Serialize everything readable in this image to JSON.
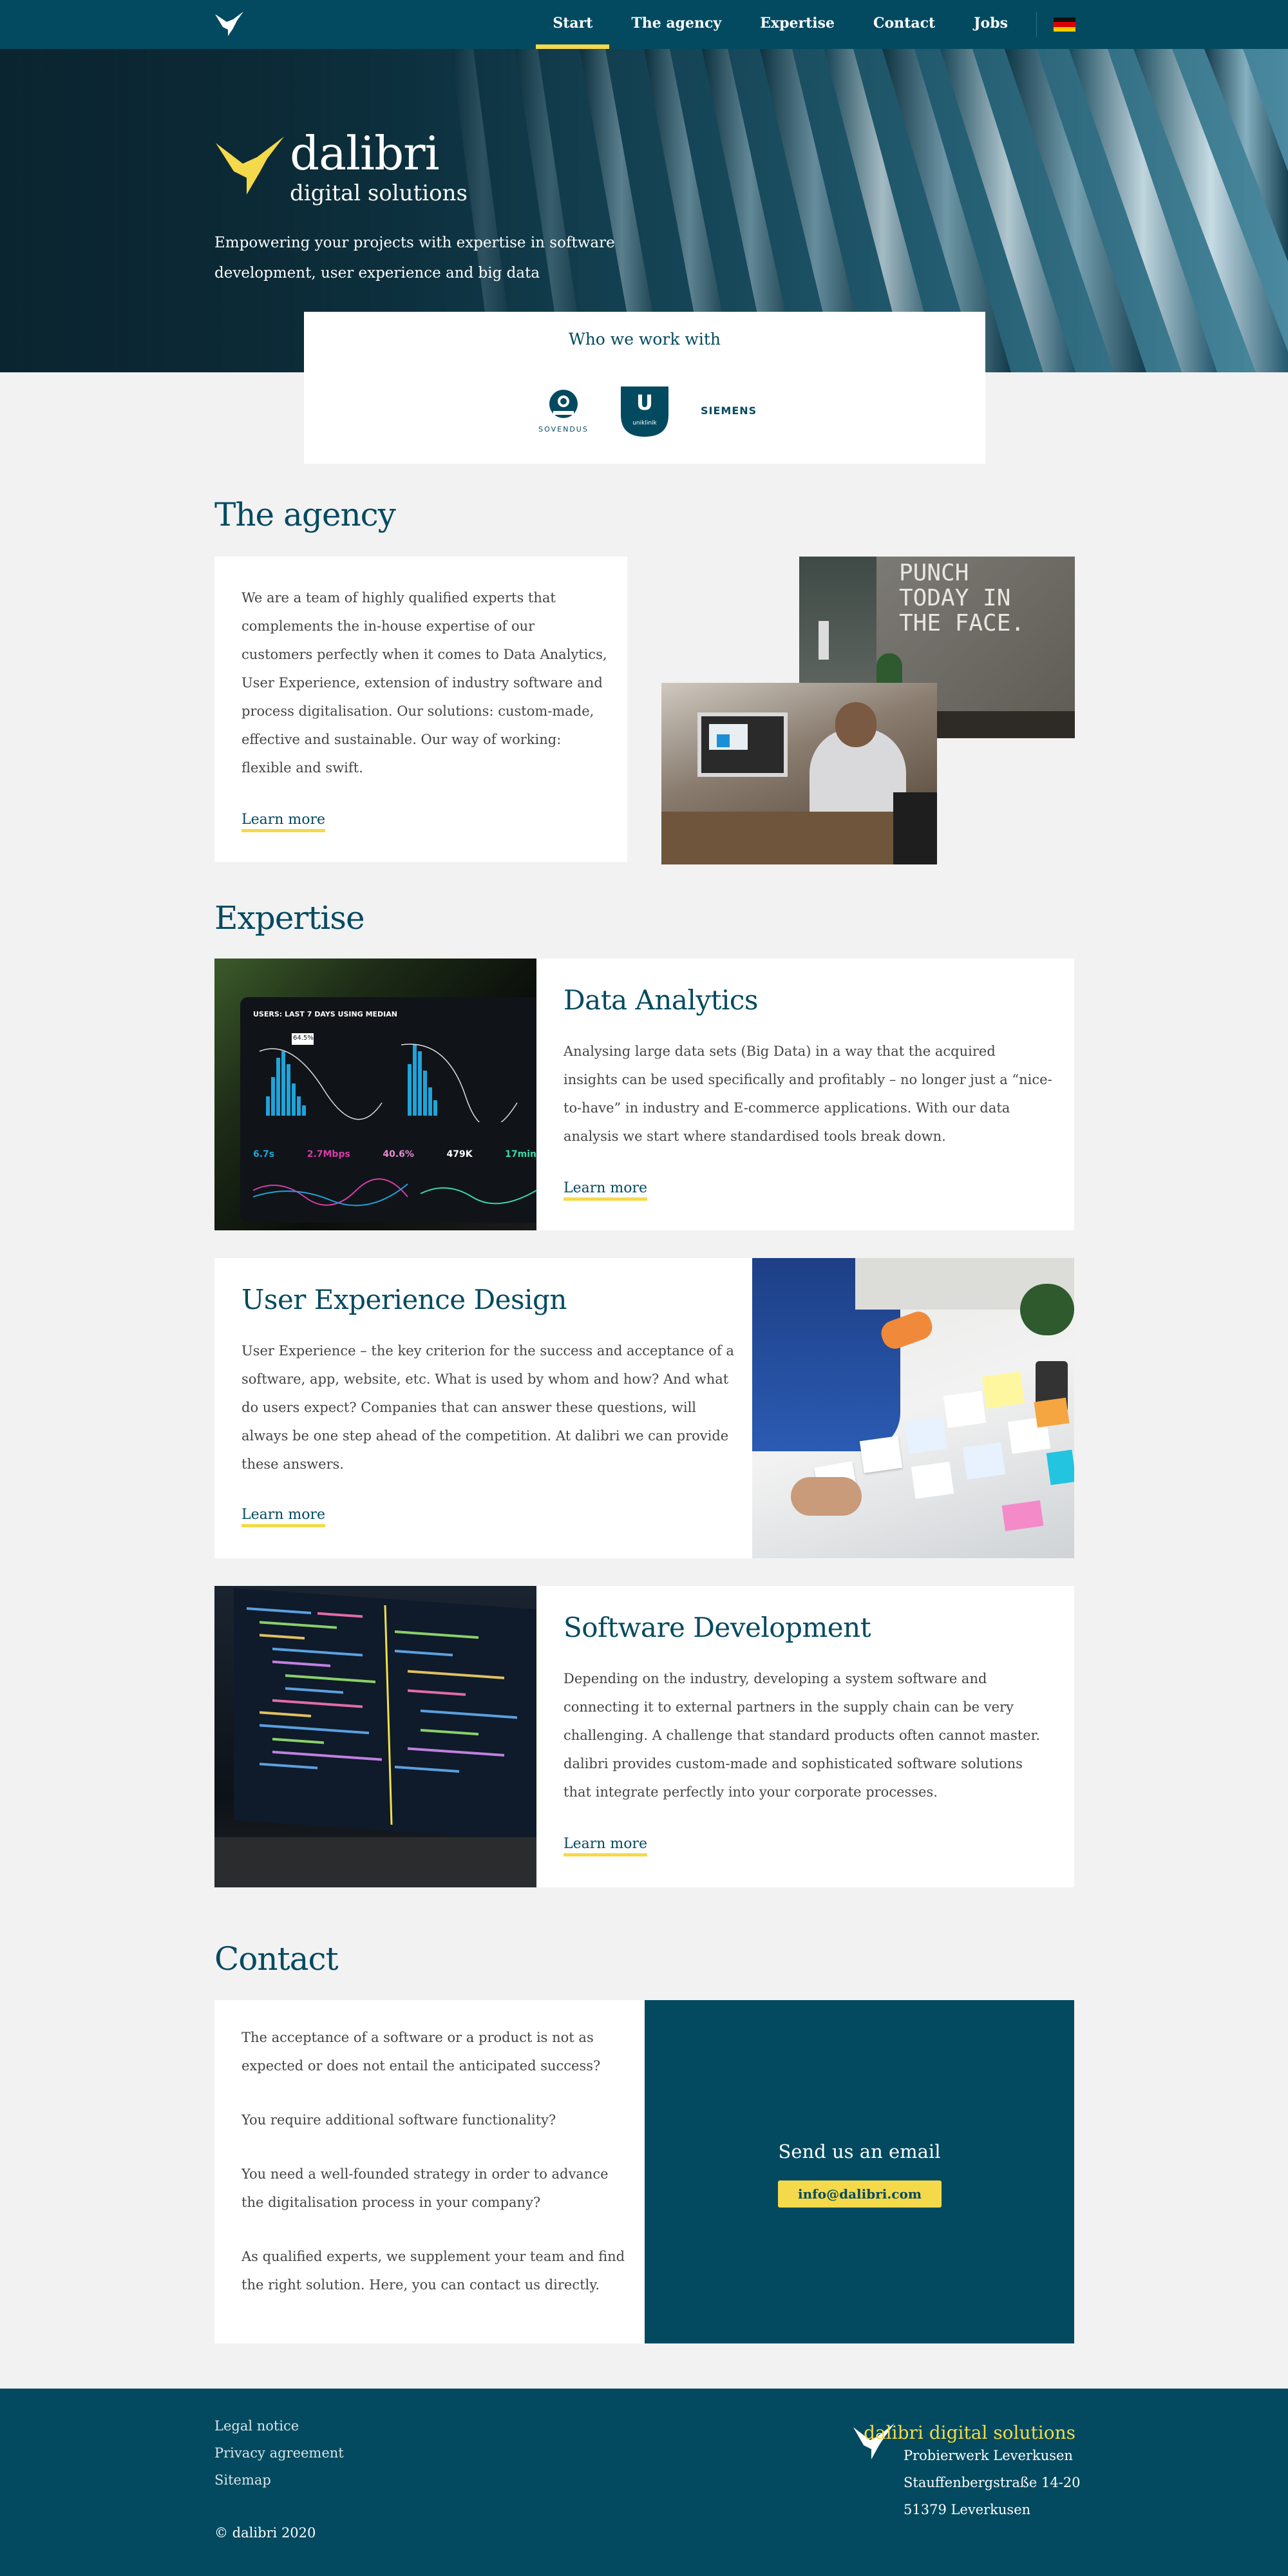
{
  "nav": {
    "items": [
      {
        "label": "Start",
        "active": true
      },
      {
        "label": "The agency"
      },
      {
        "label": "Expertise"
      },
      {
        "label": "Contact"
      },
      {
        "label": "Jobs"
      }
    ],
    "language_flag": "german-flag-icon"
  },
  "hero": {
    "brand": "dalibri",
    "subbrand": "digital solutions",
    "tagline": "Empowering your projects with expertise in software development, user experience and big data"
  },
  "clients": {
    "title": "Who we work with",
    "logos": [
      {
        "name": "sovendus-logo",
        "label": "SOVENDUS"
      },
      {
        "name": "uniklinik-logo",
        "label": "uniklinik",
        "mark": "U"
      },
      {
        "name": "siemens-logo",
        "label": "SIEMENS"
      }
    ]
  },
  "agency": {
    "title": "The agency",
    "text": "We are a team of highly qualified experts that complements the in-house expertise of our customers perfectly when it comes to Data Analytics, User Experience, extension of industry software and process digitalisation. Our solutions: custom-made, effective and sustainable. Our way of working: flexible and swift.",
    "learn_more": "Learn more",
    "wall_text": "PUNCH TODAY IN THE FACE."
  },
  "expertise": {
    "title": "Expertise",
    "cards": [
      {
        "title": "Data Analytics",
        "text": "Analysing large data sets (Big Data) in a way that the acquired insights can be used specifically and profitably – no longer just a “nice-to-have” in industry and E-commerce applications. With our data analysis we start where standardised tools break down.",
        "learn_more": "Learn more"
      },
      {
        "title": "User Experience Design",
        "text": "User Experience – the key criterion for the success and acceptance of a software, app, website, etc. What is used by whom and how? And what do users expect? Companies that can answer these questions, will always be one step ahead of the competition. At dalibri we can provide these answers.",
        "learn_more": "Learn more"
      },
      {
        "title": "Software Development",
        "text": "Depending on the industry, developing a system software and connecting it to external partners in the supply chain can be very challenging. A challenge that standard products often cannot master. dalibri provides custom-made and sophisticated software solutions that integrate perfectly into your corporate processes.",
        "learn_more": "Learn more"
      }
    ],
    "dashboard": {
      "header": "USERS: LAST 7 DAYS USING MEDIAN",
      "badge": "64.5%",
      "stats": [
        "6.7s",
        "2.7Mbps",
        "40.6%",
        "479K",
        "17min"
      ]
    }
  },
  "contact": {
    "title": "Contact",
    "paragraphs": [
      "The acceptance of a software or a product is not as expected or does not entail the anticipated success?",
      "You require additional software functionality?",
      "You need a well-founded strategy in order to advance the digitalisation process in your company?",
      "As qualified experts, we supplement your team and find the right solution. Here, you can contact us directly."
    ],
    "mail_title": "Send us an email",
    "email": "info@dalibri.com"
  },
  "footer": {
    "links": [
      "Legal notice",
      "Privacy agreement",
      "Sitemap"
    ],
    "copyright": "© dalibri 2020",
    "brand": "dalibri digital solutions",
    "address": [
      "Probierwerk Leverkusen",
      "Stauffenbergstraße 14-20",
      "51379 Leverkusen"
    ]
  },
  "colors": {
    "primary": "#034a60",
    "accent": "#f4d94b",
    "background": "#f2f2f2"
  }
}
